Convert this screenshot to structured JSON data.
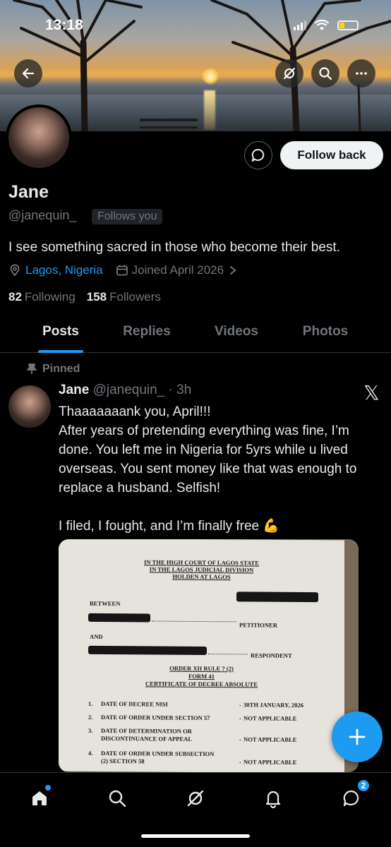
{
  "status_bar": {
    "time": "13:18"
  },
  "profile": {
    "name": "Jane",
    "handle": "@janequin_",
    "follows_you": "Follows you",
    "bio": "I see something sacred in those who become their best.",
    "location": "Lagos, Nigeria",
    "joined": "Joined April 2026",
    "following_count": "82",
    "following_label": "Following",
    "followers_count": "158",
    "followers_label": "Followers",
    "follow_button": "Follow back"
  },
  "tabs": [
    {
      "label": "Posts",
      "active": true
    },
    {
      "label": "Replies",
      "active": false
    },
    {
      "label": "Videos",
      "active": false
    },
    {
      "label": "Photos",
      "active": false
    }
  ],
  "tweet": {
    "pinned_label": "Pinned",
    "author_name": "Jane",
    "author_handle": "@janequin_",
    "time": "· 3h",
    "body": "Thaaaaaaank you, April!!!\nAfter years of pretending everything was fine, I’m done. You left me in Nigeria for 5yrs while u lived overseas. You sent money like that was enough to replace a husband. Selfish!\n\nI filed, I fought, and I’m finally free 💪"
  },
  "document": {
    "court_line1": "IN THE HIGH COURT OF LAGOS STATE",
    "court_line2": "IN THE LAGOS JUDICIAL DIVISION",
    "court_line3": "HOLDEN AT LAGOS",
    "between": "BETWEEN",
    "petitioner": "PETITIONER",
    "and": "AND",
    "respondent": "RESPONDENT",
    "order": "ORDER XII RULE 7 (2)",
    "form": "FORM 41",
    "certificate": "CERTIFICATE OF DECREE ABSOLUTE",
    "rows": [
      {
        "num": "1.",
        "label": "DATE OF DECREE NISI",
        "value": "30TH JANUARY, 2026"
      },
      {
        "num": "2.",
        "label": "DATE OF ORDER UNDER SECTION 57",
        "value": "NOT APPLICABLE"
      },
      {
        "num": "3.",
        "label": "DATE OF DETERMINATION OR",
        "label2": "DISCONTINUANCE OF APPEAL",
        "value": "NOT APPLICABLE"
      },
      {
        "num": "4.",
        "label": "DATE OF ORDER UNDER SUBSECTION",
        "label2": "(2) SECTION 58",
        "value": "NOT APPLICABLE"
      }
    ]
  },
  "bottom_nav": {
    "messages_badge": "2"
  },
  "colors": {
    "accent": "#1d9bf0",
    "background": "#000000",
    "text": "#e7e9ea",
    "muted": "#71767b"
  }
}
